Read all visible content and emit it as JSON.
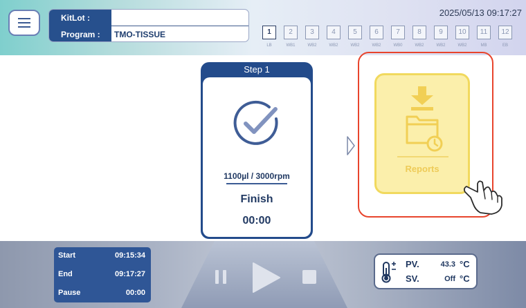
{
  "header": {
    "kitlot_label": "KitLot :",
    "kitlot_value": "",
    "program_label": "Program :",
    "program_value": "TMO-TISSUE",
    "datetime": "2025/05/13 09:17:27",
    "steps": [
      {
        "num": "1",
        "sub": "LB"
      },
      {
        "num": "2",
        "sub": "WB1"
      },
      {
        "num": "3",
        "sub": "WB2"
      },
      {
        "num": "4",
        "sub": "WB2"
      },
      {
        "num": "5",
        "sub": "WB2"
      },
      {
        "num": "6",
        "sub": "WB2"
      },
      {
        "num": "7",
        "sub": "WB0"
      },
      {
        "num": "8",
        "sub": "WB2"
      },
      {
        "num": "9",
        "sub": "WB2"
      },
      {
        "num": "10",
        "sub": "WB2"
      },
      {
        "num": "11",
        "sub": "MB"
      },
      {
        "num": "12",
        "sub": "EB"
      }
    ],
    "active_step": "1"
  },
  "step_panel": {
    "title": "Step 1",
    "params": "1100µl / 3000rpm",
    "status": "Finish",
    "time": "00:00"
  },
  "reports": {
    "label": "Reports"
  },
  "times": {
    "start_label": "Start",
    "start_value": "09:15:34",
    "end_label": "End",
    "end_value": "09:17:27",
    "pause_label": "Pause",
    "pause_value": "00:00"
  },
  "temperature": {
    "pv_label": "PV.",
    "pv_value": "43.3",
    "pv_unit": "°C",
    "sv_label": "SV.",
    "sv_value": "Off",
    "sv_unit": "°C"
  },
  "colors": {
    "primary": "#234b8b",
    "reports_bg": "#fbefab",
    "highlight": "#e8442c"
  },
  "icons": [
    "menu-icon",
    "check-circle-icon",
    "next-arrow-icon",
    "download-folder-icon",
    "hand-pointer-icon",
    "pause-icon",
    "play-icon",
    "stop-icon",
    "thermometer-icon"
  ]
}
